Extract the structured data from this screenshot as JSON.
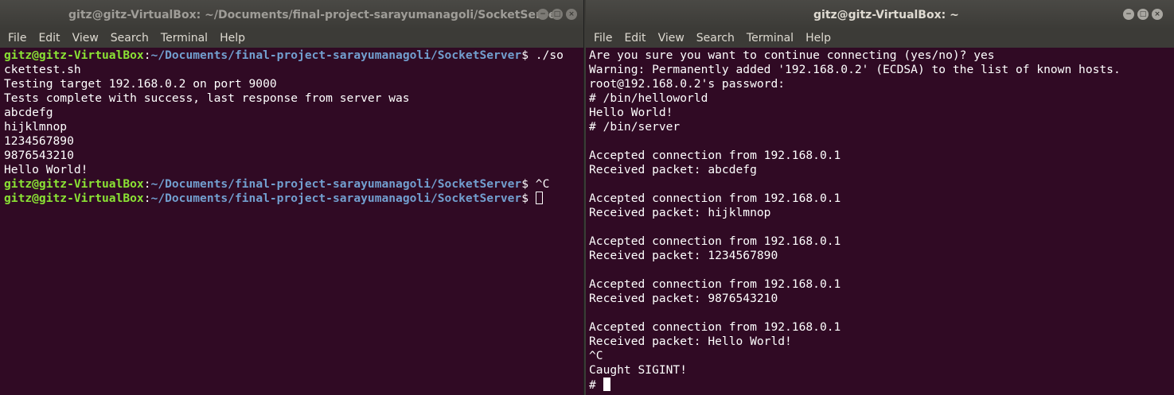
{
  "left_window": {
    "title": "gitz@gitz-VirtualBox: ~/Documents/final-project-sarayumanagoli/SocketServer",
    "menu": [
      "File",
      "Edit",
      "View",
      "Search",
      "Terminal",
      "Help"
    ],
    "prompt_user": "gitz@gitz-VirtualBox",
    "prompt_path": "~/Documents/final-project-sarayumanagoli/SocketServer",
    "lines": [
      {
        "prompt": true,
        "cmd": " ./so"
      },
      {
        "text": "ckettest.sh"
      },
      {
        "text": "Testing target 192.168.0.2 on port 9000"
      },
      {
        "text": "Tests complete with success, last response from server was"
      },
      {
        "text": "abcdefg"
      },
      {
        "text": "hijklmnop"
      },
      {
        "text": "1234567890"
      },
      {
        "text": "9876543210"
      },
      {
        "text": "Hello World!"
      },
      {
        "prompt": true,
        "cmd": " ^C"
      },
      {
        "prompt": true,
        "cmd": " ",
        "cursor": true
      }
    ]
  },
  "right_window": {
    "title": "gitz@gitz-VirtualBox: ~",
    "menu": [
      "File",
      "Edit",
      "View",
      "Search",
      "Terminal",
      "Help"
    ],
    "lines": [
      "Are you sure you want to continue connecting (yes/no)? yes",
      "Warning: Permanently added '192.168.0.2' (ECDSA) to the list of known hosts.",
      "root@192.168.0.2's password: ",
      "# /bin/helloworld",
      "Hello World!",
      "# /bin/server",
      "",
      "Accepted connection from 192.168.0.1",
      "Received packet: abcdefg",
      "",
      "Accepted connection from 192.168.0.1",
      "Received packet: hijklmnop",
      "",
      "Accepted connection from 192.168.0.1",
      "Received packet: 1234567890",
      "",
      "Accepted connection from 192.168.0.1",
      "Received packet: 9876543210",
      "",
      "Accepted connection from 192.168.0.1",
      "Received packet: Hello World!",
      "^C",
      "Caught SIGINT!"
    ],
    "final_prompt": "# "
  },
  "window_buttons": {
    "minimize": "−",
    "maximize": "□",
    "close": "×"
  },
  "colors": {
    "terminal_bg": "#300a24",
    "prompt_user": "#8ae234",
    "prompt_path": "#729fcf",
    "titlebar": "#3c3b37"
  }
}
